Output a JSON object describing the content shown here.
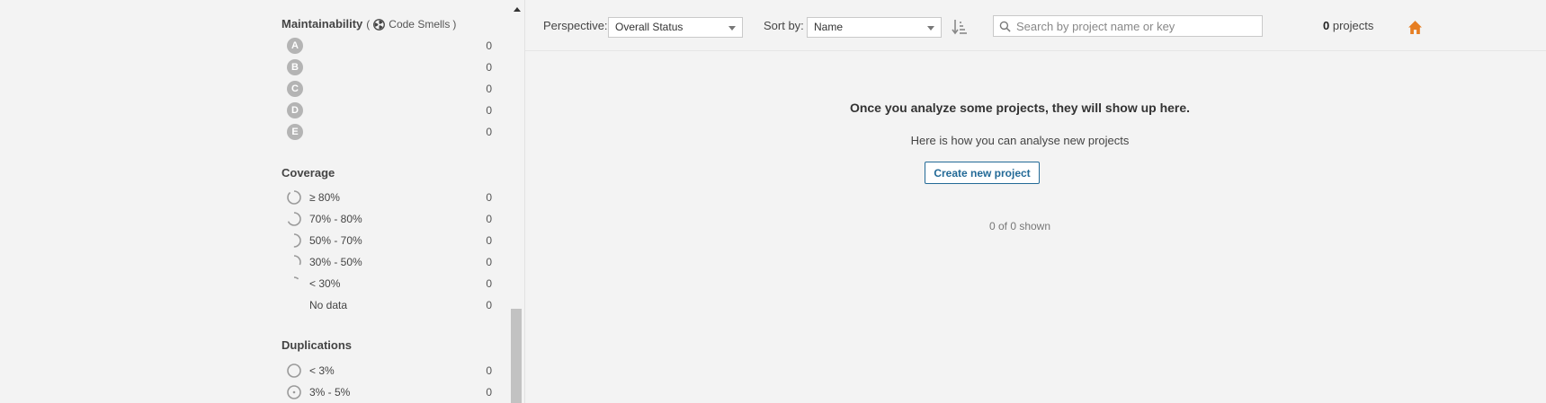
{
  "sidebar": {
    "maintainability": {
      "title": "Maintainability",
      "paren_open": "(",
      "metric": "Code Smells",
      "paren_close": ")",
      "rows": [
        {
          "label": "A",
          "count": "0"
        },
        {
          "label": "B",
          "count": "0"
        },
        {
          "label": "C",
          "count": "0"
        },
        {
          "label": "D",
          "count": "0"
        },
        {
          "label": "E",
          "count": "0"
        }
      ]
    },
    "coverage": {
      "title": "Coverage",
      "rows": [
        {
          "label": "≥ 80%",
          "count": "0"
        },
        {
          "label": "70% - 80%",
          "count": "0"
        },
        {
          "label": "50% - 70%",
          "count": "0"
        },
        {
          "label": "30% - 50%",
          "count": "0"
        },
        {
          "label": "< 30%",
          "count": "0"
        },
        {
          "label": "No data",
          "count": "0"
        }
      ]
    },
    "duplications": {
      "title": "Duplications",
      "rows": [
        {
          "label": "< 3%",
          "count": "0"
        },
        {
          "label": "3% - 5%",
          "count": "0"
        }
      ]
    }
  },
  "toolbar": {
    "perspective_label": "Perspective:",
    "perspective_value": "Overall Status",
    "sort_label": "Sort by:",
    "sort_value": "Name",
    "search_placeholder": "Search by project name or key",
    "project_count": "0",
    "project_count_suffix": " projects"
  },
  "main": {
    "empty_title": "Once you analyze some projects, they will show up here.",
    "empty_subtitle": "Here is how you can analyse new projects",
    "create_button": "Create new project",
    "shown_text": "0 of 0 shown"
  },
  "colors": {
    "accent": "#236a97",
    "home_icon": "#e67e22",
    "rating_gray": "#b4b4b4"
  }
}
